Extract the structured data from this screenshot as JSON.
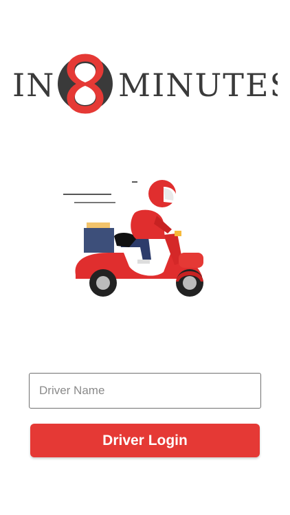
{
  "brand": {
    "logo_left_text": "IN",
    "logo_digit": "8",
    "logo_right_text": "MINUTES",
    "accent_color": "#e53935",
    "dark_color": "#3a3a3a"
  },
  "illustration": {
    "icon": "delivery-scooter-rider"
  },
  "form": {
    "driver_name_placeholder": "Driver Name",
    "driver_name_value": "",
    "login_label": "Driver Login"
  }
}
